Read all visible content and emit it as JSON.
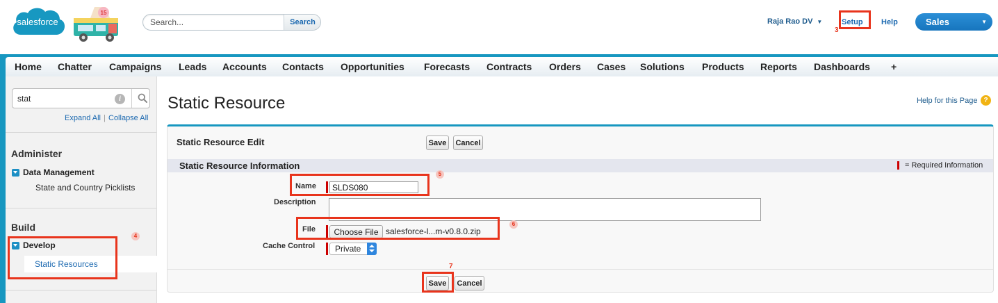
{
  "header": {
    "logo_text": "salesforce",
    "doodle_badge": "15",
    "search": {
      "placeholder": "Search...",
      "button_label": "Search"
    },
    "user_name": "Raja Rao DV",
    "setup_label": "Setup",
    "help_label": "Help",
    "app_name": "Sales"
  },
  "tabs": [
    "Home",
    "Chatter",
    "Campaigns",
    "Leads",
    "Accounts",
    "Contacts",
    "Opportunities",
    "Forecasts",
    "Contracts",
    "Orders",
    "Cases",
    "Solutions",
    "Products",
    "Reports",
    "Dashboards",
    "+"
  ],
  "sidebar": {
    "quickfind_value": "stat",
    "expand_all": "Expand All",
    "separator": "|",
    "collapse_all": "Collapse All",
    "administer": {
      "heading": "Administer",
      "group": "Data Management",
      "items": [
        "State and Country Picklists"
      ]
    },
    "build": {
      "heading": "Build",
      "group": "Develop",
      "items": [
        "Static Resources"
      ]
    }
  },
  "main": {
    "page_title": "Static Resource",
    "help_for_page": "Help for this Page",
    "panel": {
      "title": "Static Resource Edit",
      "save_label": "Save",
      "cancel_label": "Cancel",
      "section_title": "Static Resource Information",
      "required_info": "= Required Information",
      "fields": {
        "name": {
          "label": "Name",
          "value": "SLDS080"
        },
        "description": {
          "label": "Description",
          "value": ""
        },
        "file": {
          "label": "File",
          "button": "Choose File",
          "file_name": "salesforce-l...m-v0.8.0.zip"
        },
        "cache_control": {
          "label": "Cache Control",
          "value": "Private"
        }
      }
    }
  },
  "annotations": {
    "setup_step": "3",
    "develop_step": "4",
    "name_step": "5",
    "file_step": "6",
    "save_step": "7"
  },
  "colors": {
    "brand_blue": "#1797c0",
    "link_blue": "#1c69b0",
    "annotation_red": "#e8341c",
    "required_red": "#cc0000"
  }
}
